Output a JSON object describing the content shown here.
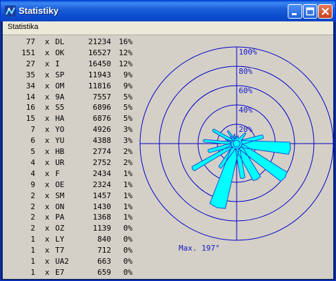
{
  "window": {
    "title": "Statistiky",
    "app_icon": "satellite-dish-icon",
    "controls": [
      "minimize-icon",
      "maximize-icon",
      "close-icon"
    ]
  },
  "menu": {
    "items": [
      "Statistika"
    ]
  },
  "stats": [
    {
      "count": "77",
      "x": "x",
      "call": "DL",
      "dist": "21234",
      "pct": "16%"
    },
    {
      "count": "151",
      "x": "x",
      "call": "OK",
      "dist": "16527",
      "pct": "12%"
    },
    {
      "count": "27",
      "x": "x",
      "call": "I",
      "dist": "16450",
      "pct": "12%"
    },
    {
      "count": "35",
      "x": "x",
      "call": "SP",
      "dist": "11943",
      "pct": "9%"
    },
    {
      "count": "34",
      "x": "x",
      "call": "OM",
      "dist": "11816",
      "pct": "9%"
    },
    {
      "count": "14",
      "x": "x",
      "call": "9A",
      "dist": "7557",
      "pct": "5%"
    },
    {
      "count": "16",
      "x": "x",
      "call": "S5",
      "dist": "6896",
      "pct": "5%"
    },
    {
      "count": "15",
      "x": "x",
      "call": "HA",
      "dist": "6876",
      "pct": "5%"
    },
    {
      "count": "7",
      "x": "x",
      "call": "YO",
      "dist": "4926",
      "pct": "3%"
    },
    {
      "count": "6",
      "x": "x",
      "call": "YU",
      "dist": "4388",
      "pct": "3%"
    },
    {
      "count": "5",
      "x": "x",
      "call": "HB",
      "dist": "2774",
      "pct": "2%"
    },
    {
      "count": "4",
      "x": "x",
      "call": "UR",
      "dist": "2752",
      "pct": "2%"
    },
    {
      "count": "4",
      "x": "x",
      "call": "F",
      "dist": "2434",
      "pct": "1%"
    },
    {
      "count": "9",
      "x": "x",
      "call": "OE",
      "dist": "2324",
      "pct": "1%"
    },
    {
      "count": "2",
      "x": "x",
      "call": "SM",
      "dist": "1457",
      "pct": "1%"
    },
    {
      "count": "2",
      "x": "x",
      "call": "ON",
      "dist": "1430",
      "pct": "1%"
    },
    {
      "count": "2",
      "x": "x",
      "call": "PA",
      "dist": "1368",
      "pct": "1%"
    },
    {
      "count": "2",
      "x": "x",
      "call": "OZ",
      "dist": "1139",
      "pct": "0%"
    },
    {
      "count": "1",
      "x": "x",
      "call": "LY",
      "dist": "840",
      "pct": "0%"
    },
    {
      "count": "1",
      "x": "x",
      "call": "T7",
      "dist": "712",
      "pct": "0%"
    },
    {
      "count": "1",
      "x": "x",
      "call": "UA2",
      "dist": "663",
      "pct": "0%"
    },
    {
      "count": "1",
      "x": "x",
      "call": "E7",
      "dist": "659",
      "pct": "0%"
    }
  ],
  "polar": {
    "ring_labels": [
      "20%",
      "40%",
      "60%",
      "80%",
      "100%"
    ],
    "max_label": "Max. 197°",
    "colors": {
      "grid": "#0000c8",
      "fill": "#00ffff",
      "outline": "#1a4fd0",
      "labels": "#1515c8"
    },
    "lobes": [
      {
        "angle": -70,
        "len": 12,
        "w": 6
      },
      {
        "angle": -40,
        "len": 10,
        "w": 8
      },
      {
        "angle": -20,
        "len": 6,
        "w": 5
      },
      {
        "angle": 10,
        "len": 8,
        "w": 6
      },
      {
        "angle": 40,
        "len": 14,
        "w": 10
      },
      {
        "angle": 75,
        "len": 28,
        "w": 14
      },
      {
        "angle": 95,
        "len": 55,
        "w": 24
      },
      {
        "angle": 125,
        "len": 60,
        "w": 20
      },
      {
        "angle": 150,
        "len": 42,
        "w": 22
      },
      {
        "angle": 170,
        "len": 36,
        "w": 14
      },
      {
        "angle": 197,
        "len": 68,
        "w": 26
      },
      {
        "angle": 215,
        "len": 30,
        "w": 12
      },
      {
        "angle": 240,
        "len": 52,
        "w": 10
      },
      {
        "angle": 255,
        "len": 30,
        "w": 12
      },
      {
        "angle": 275,
        "len": 34,
        "w": 8
      },
      {
        "angle": 300,
        "len": 28,
        "w": 10
      },
      {
        "angle": 325,
        "len": 16,
        "w": 8
      },
      {
        "angle": 345,
        "len": 10,
        "w": 6
      }
    ]
  }
}
